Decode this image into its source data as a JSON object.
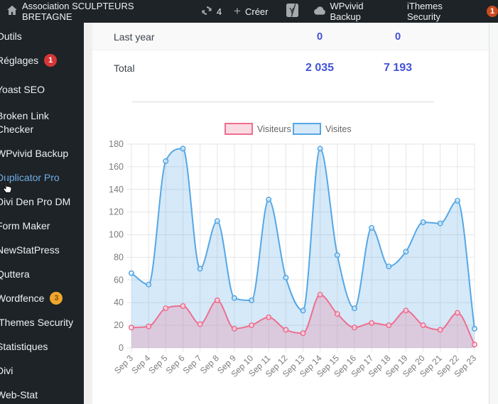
{
  "admin_bar": {
    "site_name": "Association SCULPTEURS BRETAGNE",
    "update_count": "4",
    "new_label": "Créer",
    "wpvivid_label": "WPvivid Backup",
    "ithemes_label": "iThemes Security",
    "ithemes_badge": "1"
  },
  "sidebar": {
    "items": [
      {
        "slug": "outils",
        "label": "Outils"
      },
      {
        "slug": "reglages",
        "label": "Réglages",
        "badge": "1",
        "badge_bg": "#d63638",
        "badge_fg": "#ffffff"
      },
      {
        "slug": "yoast-seo",
        "label": "Yoast SEO"
      },
      {
        "slug": "broken-link-checker",
        "label": "Broken Link Checker"
      },
      {
        "slug": "wpvivid-backup",
        "label": "WPvivid Backup"
      },
      {
        "slug": "duplicator-pro",
        "label": "Duplicator Pro",
        "current": true
      },
      {
        "slug": "divi-den-pro-dm",
        "label": "Divi Den Pro DM"
      },
      {
        "slug": "form-maker",
        "label": "Form Maker"
      },
      {
        "slug": "newstatpress",
        "label": "NewStatPress"
      },
      {
        "slug": "quttera",
        "label": "Quttera"
      },
      {
        "slug": "wordfence",
        "label": "Wordfence",
        "badge": "3",
        "badge_bg": "#efa72e",
        "badge_fg": "#8a5110"
      },
      {
        "slug": "ithemes-security",
        "label": "iThemes Security"
      },
      {
        "slug": "statistiques",
        "label": "Statistiques"
      },
      {
        "slug": "divi",
        "label": "Divi"
      },
      {
        "slug": "web-stat",
        "label": "Web-Stat"
      }
    ]
  },
  "stats_table": {
    "rows": [
      {
        "label": "Last year",
        "values": [
          "0",
          "0"
        ]
      },
      {
        "label": "Total",
        "values": [
          "2 035",
          "7 193"
        ]
      }
    ]
  },
  "chart_data": {
    "type": "area",
    "x": [
      "Sep 3",
      "Sep 4",
      "Sep 5",
      "Sep 6",
      "Sep 7",
      "Sep 8",
      "Sep 9",
      "Sep 10",
      "Sep 11",
      "Sep 12",
      "Sep 13",
      "Sep 14",
      "Sep 15",
      "Sep 16",
      "Sep 17",
      "Sep 18",
      "Sep 19",
      "Sep 20",
      "Sep 21",
      "Sep 22",
      "Sep 23"
    ],
    "series": [
      {
        "name": "Visiteurs",
        "color": "#ee6e8f",
        "fill": "rgba(238,110,143,0.25)",
        "values": [
          18,
          19,
          35,
          37,
          21,
          42,
          17,
          20,
          27,
          16,
          13,
          47,
          30,
          18,
          22,
          20,
          33,
          20,
          16,
          31,
          3
        ]
      },
      {
        "name": "Visites",
        "color": "#56a7e5",
        "fill": "rgba(86,167,229,0.25)",
        "values": [
          66,
          56,
          165,
          176,
          70,
          112,
          44,
          42,
          131,
          62,
          33,
          176,
          82,
          35,
          106,
          72,
          85,
          111,
          110,
          130,
          17
        ]
      }
    ],
    "ylim": [
      0,
      180
    ],
    "ytick_step": 20,
    "legend_position": "top",
    "grid": true
  },
  "colors": {
    "admin_bar_bg": "#1d2327",
    "sidebar_bg": "#1d2327",
    "current_item_text": "#72aee6",
    "table_value_text": "#4353d6",
    "settings_badge": "#d63638",
    "wordfence_badge": "#efa72e",
    "notification_badge": "#ca4a1f"
  }
}
